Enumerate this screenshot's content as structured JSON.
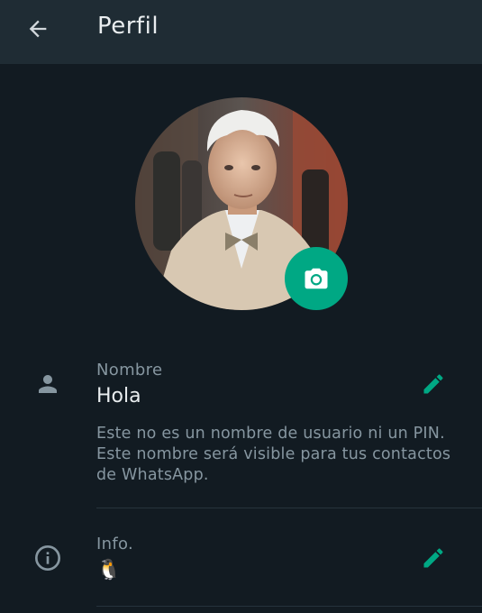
{
  "header": {
    "title": "Perfil",
    "back_icon": "arrow-left-icon"
  },
  "profile_photo": {
    "camera_icon": "camera-icon",
    "accent_color": "#00a884"
  },
  "name_section": {
    "icon": "person-icon",
    "label": "Nombre",
    "value": "Hola",
    "hint": "Este no es un nombre de usuario ni un PIN. Este nombre será visible para tus contactos de WhatsApp.",
    "edit_icon": "pencil-icon"
  },
  "info_section": {
    "icon": "info-icon",
    "label": "Info.",
    "value": "🐧",
    "edit_icon": "pencil-icon"
  }
}
